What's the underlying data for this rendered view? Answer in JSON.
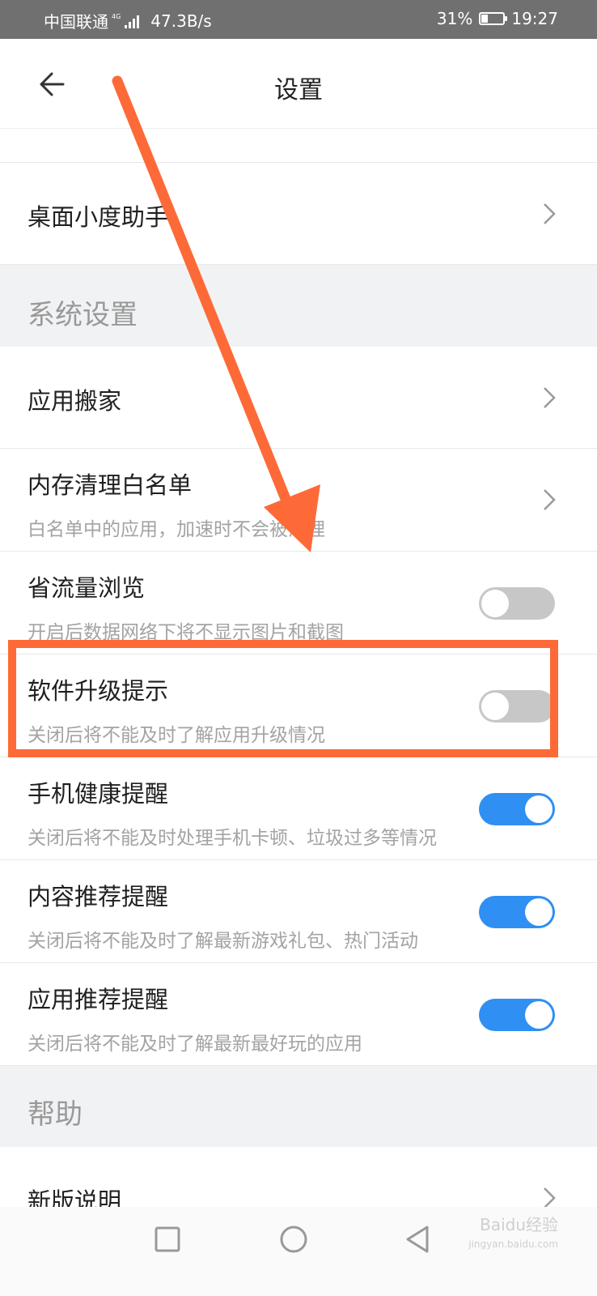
{
  "status_bar": {
    "carrier": "中国联通",
    "network_type": "4G",
    "speed": "47.3B/s",
    "battery": "31%",
    "battery_level": 0.31,
    "time": "19:27"
  },
  "header": {
    "title": "设置"
  },
  "rows": [
    {
      "label": "桌面小度助手"
    },
    {
      "label": "应用搬家"
    },
    {
      "label": "内存清理白名单",
      "sub": "白名单中的应用，加速时不会被清理"
    }
  ],
  "toggles": [
    {
      "label": "省流量浏览",
      "sub": "开启后数据网络下将不显示图片和截图",
      "on": false
    },
    {
      "label": "软件升级提示",
      "sub": "关闭后将不能及时了解应用升级情况",
      "on": false
    },
    {
      "label": "手机健康提醒",
      "sub": "关闭后将不能及时处理手机卡顿、垃圾过多等情况",
      "on": true
    },
    {
      "label": "内容推荐提醒",
      "sub": "关闭后将不能及时了解最新游戏礼包、热门活动",
      "on": true
    },
    {
      "label": "应用推荐提醒",
      "sub": "关闭后将不能及时了解最新最好玩的应用",
      "on": true
    }
  ],
  "sections": {
    "system": "系统设置",
    "help": "帮助"
  },
  "help_rows": [
    {
      "label": "新版说明"
    }
  ],
  "watermark": {
    "line1": "Baidu经验",
    "line2": "jingyan.baidu.com"
  },
  "colors": {
    "annotation": "#fd6a38",
    "toggle_on": "#2f8ff2",
    "toggle_off": "#c7c7c7"
  },
  "icons": [
    "back-arrow-icon",
    "chevron-right-icon",
    "square-nav-icon",
    "circle-nav-icon",
    "triangle-back-nav-icon"
  ]
}
